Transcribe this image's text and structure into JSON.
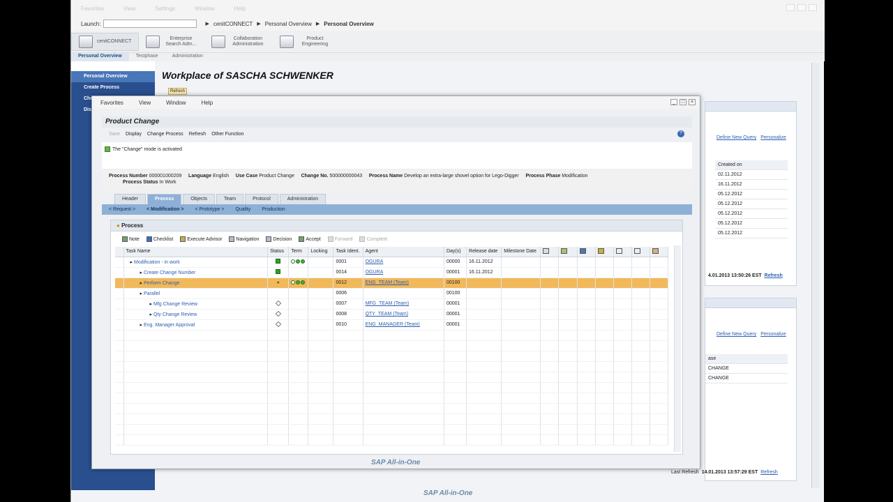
{
  "bg": {
    "menu": [
      "Favorites",
      "View",
      "Settings",
      "Window",
      "Help"
    ],
    "launch_label": "Launch:",
    "breadcrumbs": [
      "cenitCONNECT",
      "Personal Overview",
      "Personal Overview"
    ],
    "toolbar": [
      {
        "label": "cenitCONNECT"
      },
      {
        "label": "Enterprise Search Adm..."
      },
      {
        "label": "Collaboration Administration"
      },
      {
        "label": "Product Engineering"
      }
    ],
    "navtabs": [
      "Personal Overview",
      "Testphase",
      "Administration"
    ],
    "leftnav": [
      "Personal Overview",
      "Create Process",
      "Che",
      "Dis"
    ],
    "main_title": "Workplace of SASCHA SCHWENKER",
    "refresh": "Refresh",
    "panel1": {
      "define_query": "Define New Query",
      "personalize": "Personalize",
      "col_header": "Created on",
      "dates": [
        "02.11.2012",
        "16.11.2012",
        "05.12.2012",
        "05.12.2012",
        "05.12.2012",
        "05.12.2012",
        "05.12.2012"
      ],
      "footer_time": "4.01.2013 13:50:26 EST",
      "footer_refresh": "Refresh"
    },
    "panel2": {
      "define_query": "Define New Query",
      "personalize": "Personalize",
      "col_header": "ase",
      "rows": [
        "CHANGE",
        "CHANGE"
      ],
      "footer_label": "Last Refresh",
      "footer_time": "14.01.2013 13:57:29 EST",
      "footer_refresh": "Refresh"
    },
    "footer_logo": "SAP All-in-One"
  },
  "popup": {
    "menu": [
      "Favorites",
      "View",
      "Window",
      "Help"
    ],
    "title": "Product Change",
    "toolbar": {
      "save": "Save",
      "display": "Display",
      "change_process": "Change Process",
      "refresh": "Refresh",
      "other": "Other Function"
    },
    "message": "The \"Change\" mode is activated",
    "info": {
      "process_number_label": "Process Number",
      "process_number": "000001000209",
      "language_label": "Language",
      "language": "English",
      "use_case_label": "Use Case",
      "use_case": "Product Change",
      "change_no_label": "Change No.",
      "change_no": "500000000043",
      "process_name_label": "Process Name",
      "process_name": "Develop an extra-large shovel option for Lego-Digger",
      "process_phase_label": "Process Phase",
      "process_phase": "Modification",
      "process_status_label": "Process Status",
      "process_status": "In Work"
    },
    "tabs": [
      "Header",
      "Process",
      "Objects",
      "Team",
      "Protocol",
      "Administration"
    ],
    "subtabs": [
      "< Request >",
      "< Modification >",
      "< Prototype >",
      "Quality",
      "Production"
    ],
    "process_title": "Process",
    "process_tools": {
      "note": "Note",
      "checklist": "Checklist",
      "execute": "Execute Advisor",
      "navigation": "Navigation",
      "decision": "Decision",
      "accept": "Accept",
      "forward": "Forward",
      "complete": "Complete"
    },
    "columns": [
      "Task Name",
      "Status",
      "Term",
      "Locking",
      "Task Ident.",
      "Agent",
      "Day(s)",
      "Release date",
      "Milestone Date"
    ],
    "rows": [
      {
        "name": "Modification - in work",
        "status": "green",
        "term": "ooo",
        "ident": "0001",
        "agent": "OGURA",
        "days": "00000",
        "release": "16.11.2012"
      },
      {
        "name": "Create Change Number",
        "status": "green",
        "term": "",
        "ident": "0014",
        "agent": "OGURA",
        "days": "00001",
        "release": "16.11.2012"
      },
      {
        "name": "Perform Change",
        "status": "user",
        "term": "ooo",
        "ident": "0012",
        "agent": "ENG_TEAM (Team)",
        "days": "00100",
        "release": ""
      },
      {
        "name": "Parallel",
        "status": "",
        "term": "",
        "ident": "0006",
        "agent": "",
        "days": "00100",
        "release": ""
      },
      {
        "name": "Mfg Change Review",
        "status": "diamond",
        "term": "",
        "ident": "0007",
        "agent": "MFG_TEAM (Team)",
        "days": "00001",
        "release": ""
      },
      {
        "name": "Qty Change Review",
        "status": "diamond",
        "term": "",
        "ident": "0008",
        "agent": "QTY_TEAM (Team)",
        "days": "00001",
        "release": ""
      },
      {
        "name": "Eng. Manager Approval",
        "status": "diamond",
        "term": "",
        "ident": "0010",
        "agent": "ENG_MANAGER (Team)",
        "days": "00001",
        "release": ""
      }
    ],
    "footer_logo": "SAP All-in-One"
  }
}
